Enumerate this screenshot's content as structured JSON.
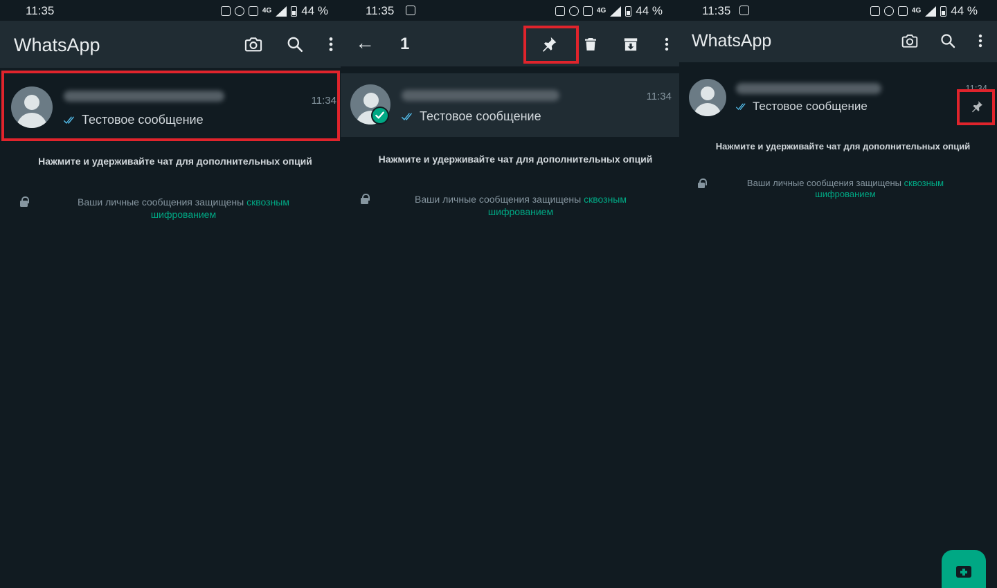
{
  "colors": {
    "background": "#111b21",
    "appbar": "#202c33",
    "accent": "#00a884",
    "ticks": "#53bdeb",
    "highlight": "#e0242c"
  },
  "status_bar": {
    "battery": "44 %",
    "network": "4G"
  },
  "panels": [
    {
      "time": "11:35",
      "app_title": "WhatsApp",
      "actions": [
        "camera-icon",
        "search-icon",
        "more-vert-icon"
      ],
      "chat": {
        "time": "11:34",
        "last_message": "Тестовое сообщение",
        "selected": false
      },
      "hint": "Нажмите и удерживайте чат для дополнительных опций",
      "e2e_text": "Ваши личные сообщения защищены",
      "e2e_link": "сквозным шифрованием"
    },
    {
      "time": "11:35",
      "selected_count": "1",
      "actions": [
        "back-arrow-icon",
        "pin-icon",
        "delete-icon",
        "archive-icon",
        "more-vert-icon"
      ],
      "chat": {
        "time": "11:34",
        "last_message": "Тестовое сообщение",
        "selected": true
      },
      "hint": "Нажмите и удерживайте чат для дополнительных опций",
      "e2e_text": "Ваши личные сообщения защищены",
      "e2e_link": "сквозным шифрованием"
    },
    {
      "time": "11:35",
      "app_title": "WhatsApp",
      "actions": [
        "camera-icon",
        "search-icon",
        "more-vert-icon"
      ],
      "chat": {
        "time": "11:34",
        "last_message": "Тестовое сообщение",
        "pinned": true
      },
      "hint": "Нажмите и удерживайте чат для дополнительных опций",
      "e2e_text": "Ваши личные сообщения защищены",
      "e2e_link": "сквозным шифрованием",
      "fab": "new-chat-icon"
    }
  ]
}
